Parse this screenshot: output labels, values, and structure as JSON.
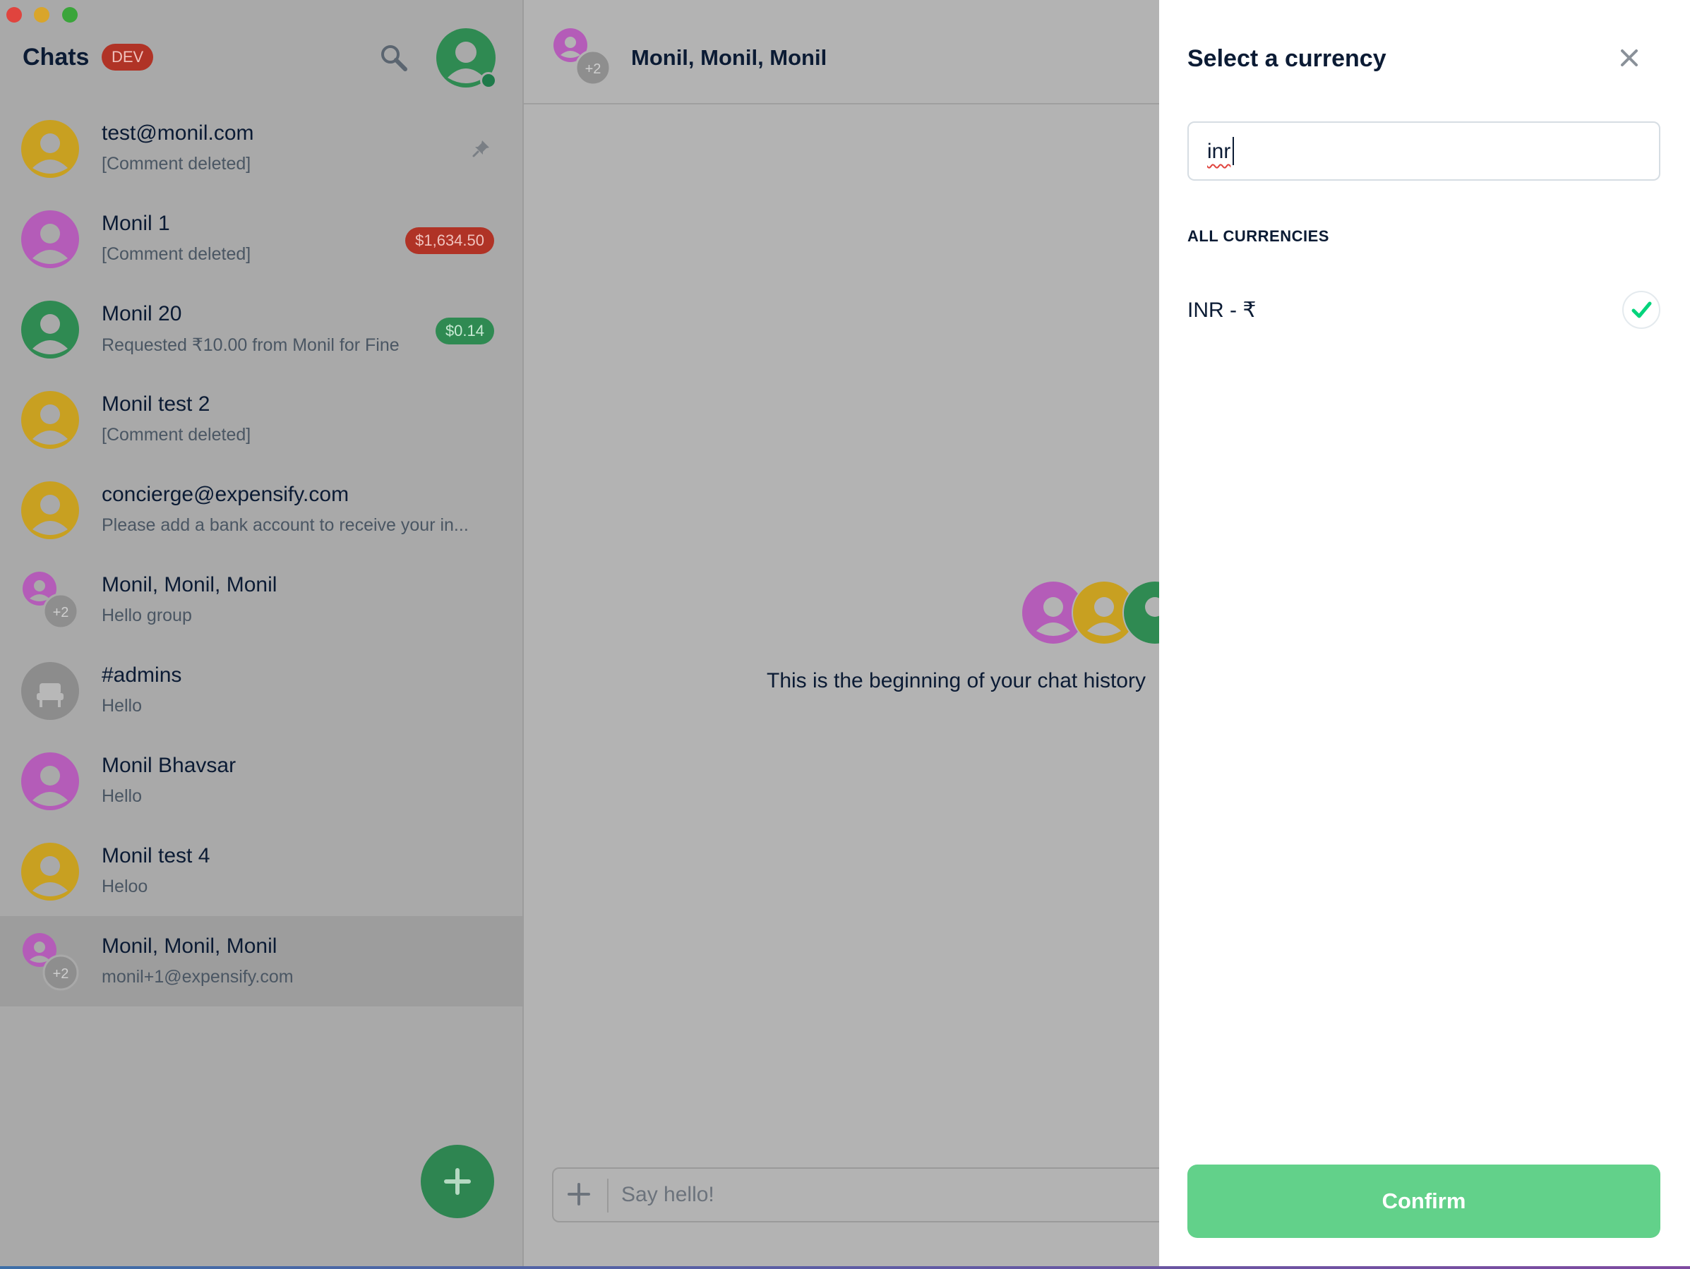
{
  "sidebar": {
    "title": "Chats",
    "env_badge": "DEV",
    "chats": [
      {
        "name": "test@monil.com",
        "preview": "[Comment deleted]",
        "avatar_color": "#c8a021",
        "pinned": true
      },
      {
        "name": "Monil 1",
        "preview": "[Comment deleted]",
        "avatar_color": "#b45cb8",
        "amount": "$1,634.50",
        "amount_color": "#b03326"
      },
      {
        "name": "Monil 20",
        "preview": "Requested ₹10.00 from Monil for Fine",
        "avatar_color": "#2f8a52",
        "amount": "$0.14",
        "amount_color": "#2f8a52"
      },
      {
        "name": "Monil test 2",
        "preview": "[Comment deleted]",
        "avatar_color": "#c8a021"
      },
      {
        "name": "concierge@expensify.com",
        "preview": "Please add a bank account to receive your in...",
        "avatar_color": "#c8a021"
      },
      {
        "name": "Monil, Monil, Monil",
        "preview": "Hello group",
        "avatar_color": "#b45cb8",
        "group_count": "+2"
      },
      {
        "name": "#admins",
        "preview": "Hello",
        "avatar_color": "#8c8c8c"
      },
      {
        "name": "Monil Bhavsar",
        "preview": "Hello",
        "avatar_color": "#b45cb8"
      },
      {
        "name": "Monil test 4",
        "preview": "Heloo",
        "avatar_color": "#c8a021"
      },
      {
        "name": "Monil, Monil, Monil",
        "preview": "monil+1@expensify.com",
        "avatar_color": "#b45cb8",
        "group_count": "+2",
        "active": true
      }
    ]
  },
  "main": {
    "title": "Monil, Monil, Monil",
    "group_count": "+2",
    "history_text": "This is the beginning of your chat history",
    "composer_placeholder": "Say hello!"
  },
  "panel": {
    "title": "Select a currency",
    "search_value": "inr",
    "section_label": "ALL CURRENCIES",
    "currencies": [
      {
        "label": "INR - ₹",
        "selected": true
      }
    ],
    "confirm_label": "Confirm"
  },
  "colors": {
    "accent_green": "#62d18a",
    "check_green": "#03d47c",
    "danger_red": "#b03326",
    "text_dark": "#0b1b34"
  }
}
